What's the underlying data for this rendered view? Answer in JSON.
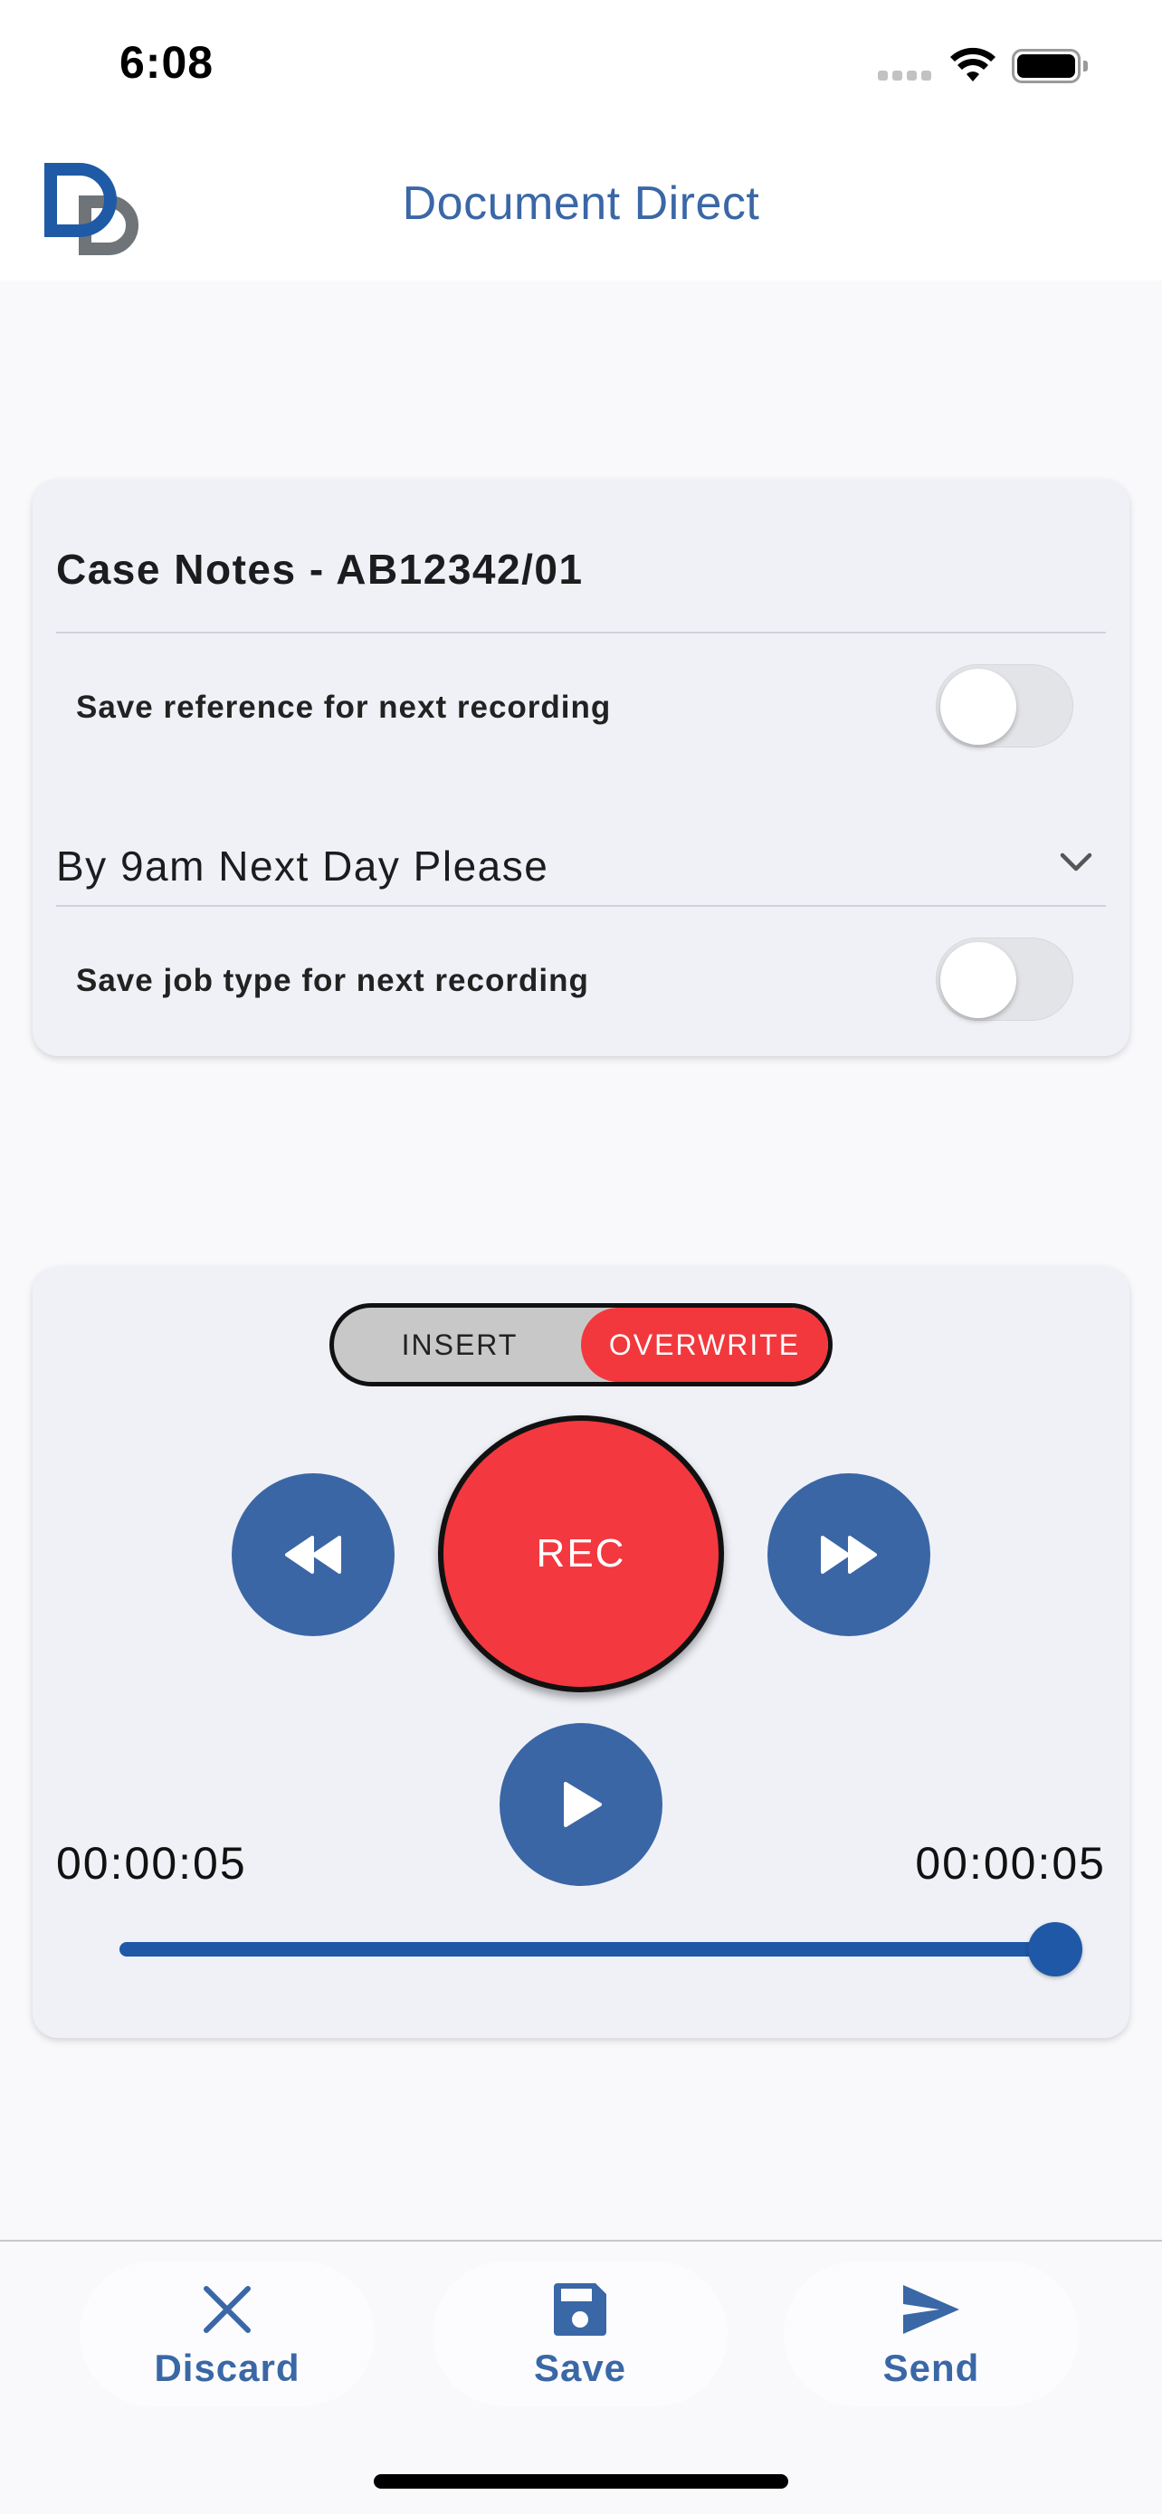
{
  "status_bar": {
    "time": "6:08"
  },
  "header": {
    "title": "Document Direct",
    "logo_icon": "document-direct-logo-icon"
  },
  "settings": {
    "reference": "Case Notes - AB12342/01",
    "save_reference_label": "Save reference for next recording",
    "save_reference_on": false,
    "job_type": "By 9am Next Day Please",
    "save_job_type_label": "Save job type for next recording",
    "save_job_type_on": false
  },
  "recorder": {
    "mode_insert": "INSERT",
    "mode_overwrite": "OVERWRITE",
    "selected_mode": "OVERWRITE",
    "rec_label": "REC",
    "elapsed": "00:00:05",
    "total": "00:00:05",
    "progress": 1.0
  },
  "bottom_bar": {
    "discard_label": "Discard",
    "save_label": "Save",
    "send_label": "Send"
  },
  "colors": {
    "brand_blue": "#3a67a6",
    "record_red": "#f3383f",
    "slider_blue": "#1f58a6"
  }
}
